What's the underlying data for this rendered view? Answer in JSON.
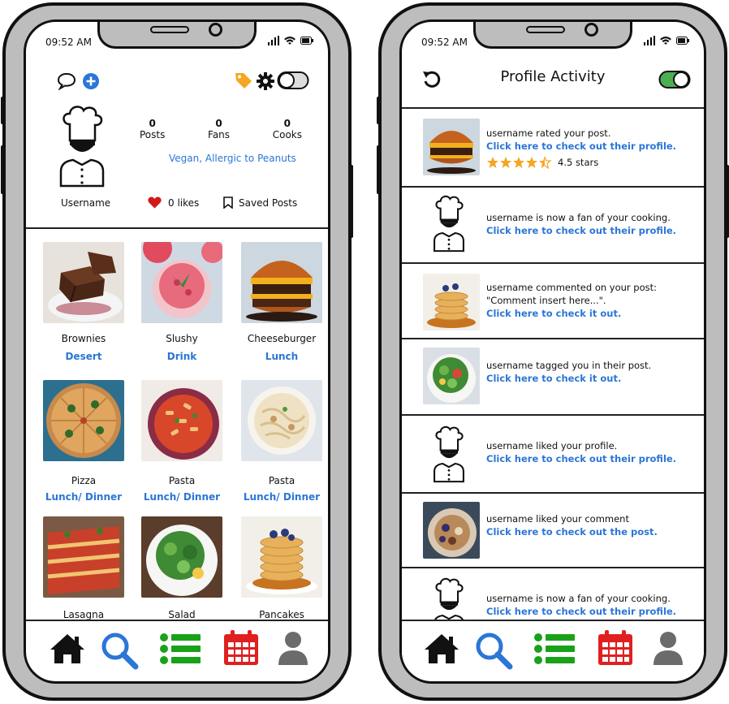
{
  "status_bar": {
    "time": "09:52 AM"
  },
  "left_screen": {
    "profile": {
      "username": "Username",
      "stats": [
        {
          "value": "0",
          "label": "Posts"
        },
        {
          "value": "0",
          "label": "Fans"
        },
        {
          "value": "0",
          "label": "Cooks"
        }
      ],
      "dietary": "Vegan, Allergic to Peanuts",
      "likes_label": "0 likes",
      "saved_label": "Saved Posts"
    },
    "grid": [
      {
        "name": "Brownies",
        "category": "Desert"
      },
      {
        "name": "Slushy",
        "category": "Drink"
      },
      {
        "name": "Cheeseburger",
        "category": "Lunch"
      },
      {
        "name": "Pizza",
        "category": "Lunch/ Dinner"
      },
      {
        "name": "Pasta",
        "category": "Lunch/ Dinner"
      },
      {
        "name": "Pasta",
        "category": "Lunch/ Dinner"
      },
      {
        "name": "Lasagna",
        "category": ""
      },
      {
        "name": "Salad",
        "category": ""
      },
      {
        "name": "Pancakes",
        "category": ""
      }
    ]
  },
  "right_screen": {
    "title": "Profile Activity",
    "activities": [
      {
        "line1": "username rated your post.",
        "link": "Click here to check out their profile.",
        "rating": "4.5 stars"
      },
      {
        "line1": "username is now a fan of your cooking.",
        "link": "Click here to check out their profile."
      },
      {
        "line1": "username commented on your post:",
        "line2": "\"Comment insert here...\".",
        "link": "Click here to check it out."
      },
      {
        "line1": "username tagged you in their post.",
        "link": "Click here to check it out."
      },
      {
        "line1": "username liked your profile.",
        "link": "Click here to check out their profile."
      },
      {
        "line1": "username liked your comment",
        "link": "Click here to check out the post."
      },
      {
        "line1": "username is now a fan of your cooking.",
        "link": "Click here to check out their profile."
      }
    ]
  },
  "colors": {
    "link_blue": "#2b76d6",
    "tag_orange": "#f5a623",
    "heart_red": "#d11b1b",
    "list_green": "#1aa11a",
    "calendar_red": "#e02020",
    "toggle_green": "#4caf50",
    "star_orange": "#f5a623"
  },
  "icons": {
    "tabs": [
      "home-icon",
      "search-icon",
      "list-icon",
      "calendar-icon",
      "profile-icon"
    ]
  }
}
